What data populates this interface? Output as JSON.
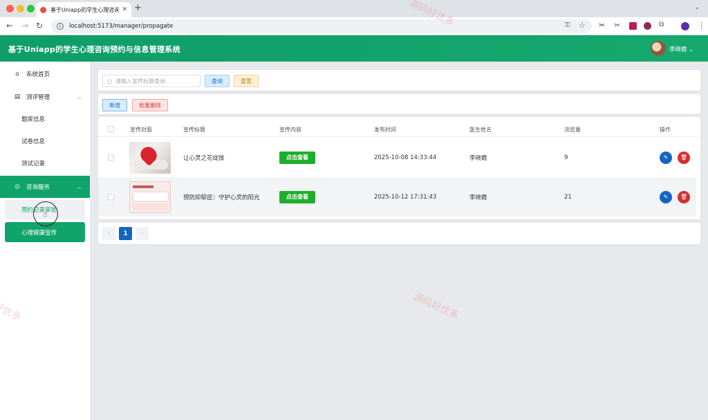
{
  "browser": {
    "tab_title": "基于Uniapp的学生心理咨询预约与信息管理系统",
    "url": "localhost:5173/manager/propagate"
  },
  "app": {
    "title": "基于Uniapp的学生心理咨询预约与信息管理系统",
    "user_name": "李晓霞"
  },
  "sidebar": {
    "home": "系统首页",
    "group_eval": "测评管理",
    "eval_items": [
      "题库信息",
      "试卷信息",
      "测试记录"
    ],
    "group_consult": "咨询服务",
    "consult_items": [
      "预约记录审批",
      "心理健康宣传"
    ]
  },
  "search": {
    "placeholder": "请输入宣传标题查询",
    "query_label": "查询",
    "reset_label": "重置"
  },
  "actions": {
    "add_label": "新增",
    "batch_delete_label": "批量删除"
  },
  "table": {
    "headers": [
      "宣传封面",
      "宣传标题",
      "宣传内容",
      "发布时间",
      "医生姓名",
      "浏览量",
      "操作"
    ],
    "view_label": "点击查看",
    "rows": [
      {
        "title": "让心灵之花绽放",
        "time": "2025-10-08 14:33:44",
        "doctor": "李晓霞",
        "views": "9"
      },
      {
        "title": "预防抑郁症：守护心灵的阳光",
        "time": "2025-10-12 17:31:43",
        "doctor": "李晓霞",
        "views": "21"
      }
    ]
  },
  "pagination": {
    "current": "1"
  },
  "colors": {
    "accent": "#10a36b",
    "primary": "#1565c0",
    "danger": "#d32f2f"
  }
}
